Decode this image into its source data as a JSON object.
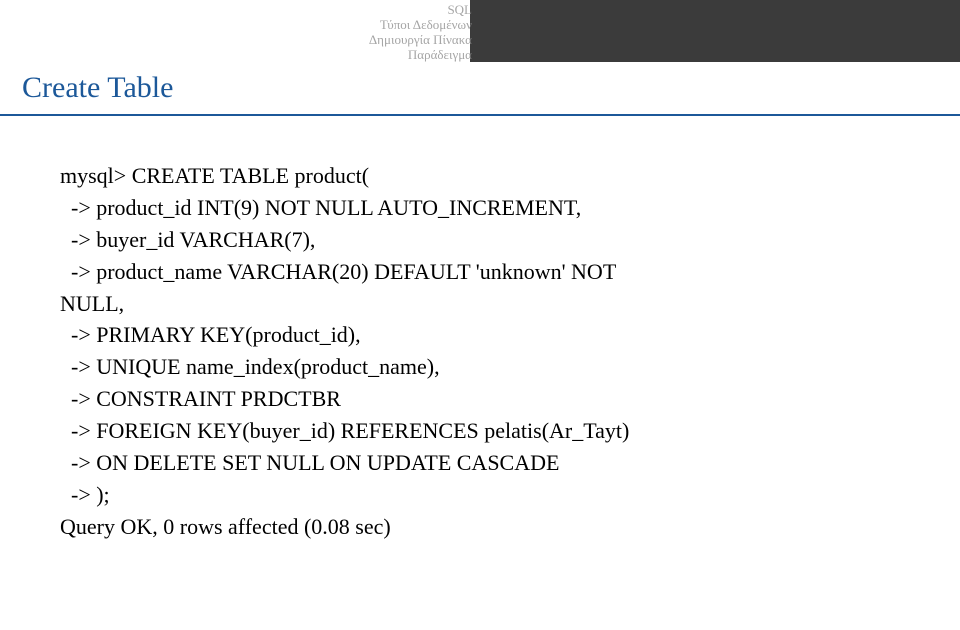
{
  "nav": {
    "line1": "SQL",
    "line2": "Τύποι Δεδομένων",
    "line3": "Δημιουργία Πίνακα",
    "line4": "Παράδειγμα"
  },
  "title": "Create Table",
  "code": {
    "l1": "mysql> CREATE TABLE product(",
    "l2": "  -> product_id INT(9) NOT NULL AUTO_INCREMENT,",
    "l3": "  -> buyer_id VARCHAR(7),",
    "l4": "  -> product_name VARCHAR(20) DEFAULT 'unknown' NOT",
    "l5": "NULL,",
    "l6": "  -> PRIMARY KEY(product_id),",
    "l7": "  -> UNIQUE name_index(product_name),",
    "l8": "  -> CONSTRAINT PRDCTBR",
    "l9": "  -> FOREIGN KEY(buyer_id) REFERENCES pelatis(Ar_Tayt)",
    "l10": "  -> ON DELETE SET NULL ON UPDATE CASCADE",
    "l11": "  -> );",
    "l12": "Query OK, 0 rows affected (0.08 sec)"
  }
}
